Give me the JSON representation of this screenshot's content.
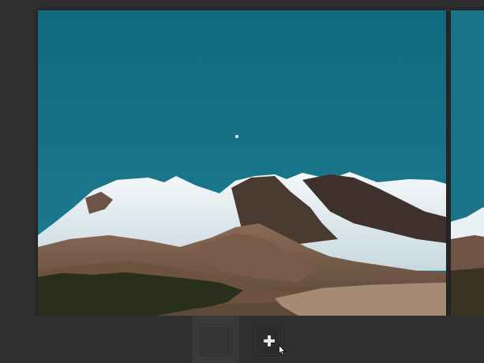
{
  "slides": [
    {
      "name": "mountain-landscape",
      "state": "current"
    },
    {
      "name": "mountain-landscape-next",
      "state": "next"
    }
  ],
  "toolbar": {
    "thumbnail_slot": "empty",
    "add_button_icon": "plus-icon"
  },
  "colors": {
    "background": "#2f2f2f",
    "sky": "#1a7488",
    "button": "#2c2c2c",
    "icon": "#e6e6e6"
  }
}
